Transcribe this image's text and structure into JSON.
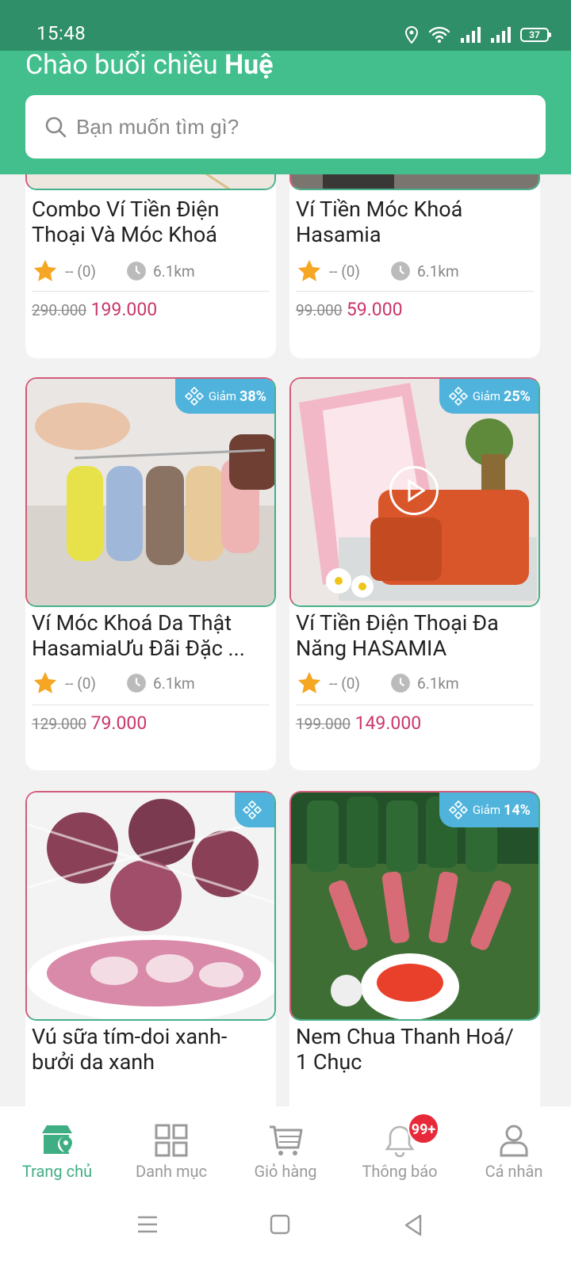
{
  "status_bar": {
    "time": "15:48",
    "battery": "37"
  },
  "header": {
    "greeting_prefix": "Chào buổi chiều",
    "greeting_name": "Huệ"
  },
  "search": {
    "placeholder": "Bạn muốn tìm gì?"
  },
  "products": [
    {
      "title": "Combo Ví Tiền Điện Thoại Và Móc Khoá",
      "rating": "-- (0)",
      "distance": "6.1km",
      "old_price": "290.000",
      "new_price": "199.000"
    },
    {
      "title": "Ví Tiền Móc Khoá Hasamia",
      "rating": "-- (0)",
      "distance": "6.1km",
      "old_price": "99.000",
      "new_price": "59.000"
    },
    {
      "title": "Ví Móc Khoá Da Thật HasamiaƯu Đãi Đặc ...",
      "rating": "-- (0)",
      "distance": "6.1km",
      "old_price": "129.000",
      "new_price": "79.000",
      "badge_label": "Giảm",
      "badge_value": "38%"
    },
    {
      "title": "Ví Tiền Điện Thoại Đa Năng HASAMIA",
      "rating": "-- (0)",
      "distance": "6.1km",
      "old_price": "199.000",
      "new_price": "149.000",
      "badge_label": "Giảm",
      "badge_value": "25%"
    },
    {
      "title": "Vú sữa tím-doi xanh-bưởi da xanh"
    },
    {
      "title": "Nem Chua Thanh Hoá/ 1 Chục",
      "badge_label": "Giảm",
      "badge_value": "14%"
    }
  ],
  "bottom_nav": {
    "items": [
      {
        "label": "Trang chủ",
        "icon": "home-store-icon"
      },
      {
        "label": "Danh mục",
        "icon": "grid-icon"
      },
      {
        "label": "Giỏ hàng",
        "icon": "cart-icon"
      },
      {
        "label": "Thông báo",
        "icon": "bell-icon"
      },
      {
        "label": "Cá nhân",
        "icon": "person-icon"
      }
    ],
    "notification_count": "99+"
  },
  "colors": {
    "primary": "#43bf8e",
    "status_bar": "#2f8f68",
    "price": "#c8366b",
    "badge": "#4fb3dc",
    "notif": "#e8293a"
  }
}
